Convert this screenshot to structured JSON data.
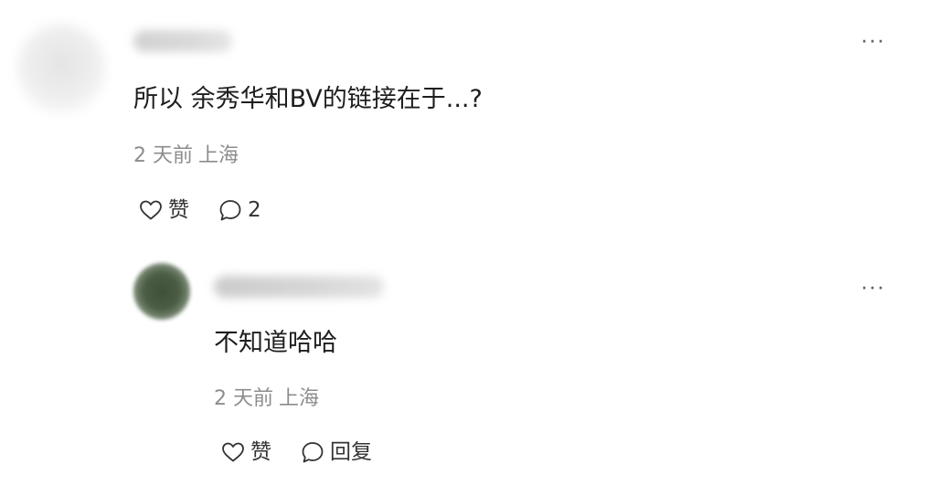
{
  "comment": {
    "text": "所以 余秀华和BV的链接在于...?",
    "time": "2 天前",
    "location": "上海",
    "like_label": "赞",
    "comment_count": "2",
    "more_label": "···"
  },
  "reply": {
    "text": "不知道哈哈",
    "time": "2 天前",
    "location": "上海",
    "like_label": "赞",
    "reply_label": "回复",
    "more_label": "···"
  },
  "icons": {
    "like": "heart-outline-icon",
    "comment": "speech-bubble-icon"
  }
}
